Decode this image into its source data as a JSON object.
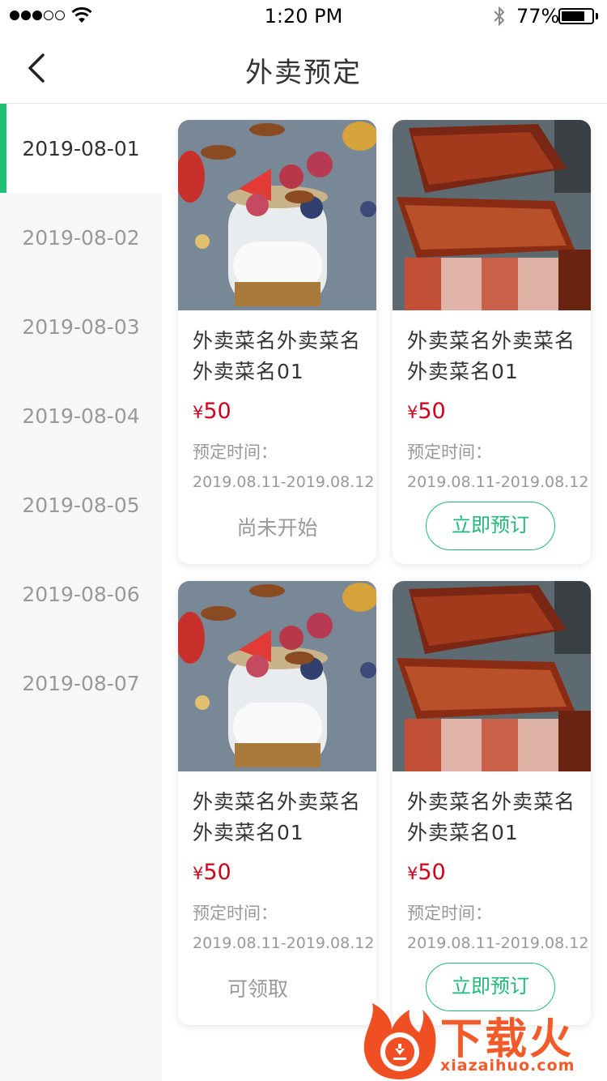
{
  "status_bar": {
    "time": "1:20 PM",
    "battery_pct": "77%",
    "battery_level": 0.77
  },
  "nav": {
    "title": "外卖预定",
    "back_icon": "chevron-left-icon"
  },
  "sidebar": {
    "dates": [
      "2019-08-01",
      "2019-08-02",
      "2019-08-03",
      "2019-08-04",
      "2019-08-05",
      "2019-08-06",
      "2019-08-07"
    ],
    "active_index": 0,
    "accent_color": "#1fc177"
  },
  "cards": [
    {
      "name": "外卖菜名外卖菜名外卖菜名01",
      "currency": "¥",
      "price": "50",
      "time_label": "预定时间：",
      "time_range": "2019.08.11-2019.08.12",
      "action": "尚未开始",
      "action_type": "status",
      "image": "yogurt-parfait"
    },
    {
      "name": "外卖菜名外卖菜名外卖菜名01",
      "currency": "¥",
      "price": "50",
      "time_label": "预定时间：",
      "time_range": "2019.08.11-2019.08.12",
      "action": "立即预订",
      "action_type": "button",
      "image": "bbq-ribs"
    },
    {
      "name": "外卖菜名外卖菜名外卖菜名01",
      "currency": "¥",
      "price": "50",
      "time_label": "预定时间：",
      "time_range": "2019.08.11-2019.08.12",
      "action": "可领取",
      "action_type": "status",
      "image": "yogurt-parfait"
    },
    {
      "name": "外卖菜名外卖菜名外卖菜名01",
      "currency": "¥",
      "price": "50",
      "time_label": "预定时间：",
      "time_range": "2019.08.11-2019.08.12",
      "action": "立即预订",
      "action_type": "button",
      "image": "bbq-ribs"
    }
  ],
  "colors": {
    "price": "#d0021b",
    "book_button": "#1fb978"
  },
  "watermark": {
    "brand": "下载火",
    "url": "xiazaihuo.com"
  }
}
